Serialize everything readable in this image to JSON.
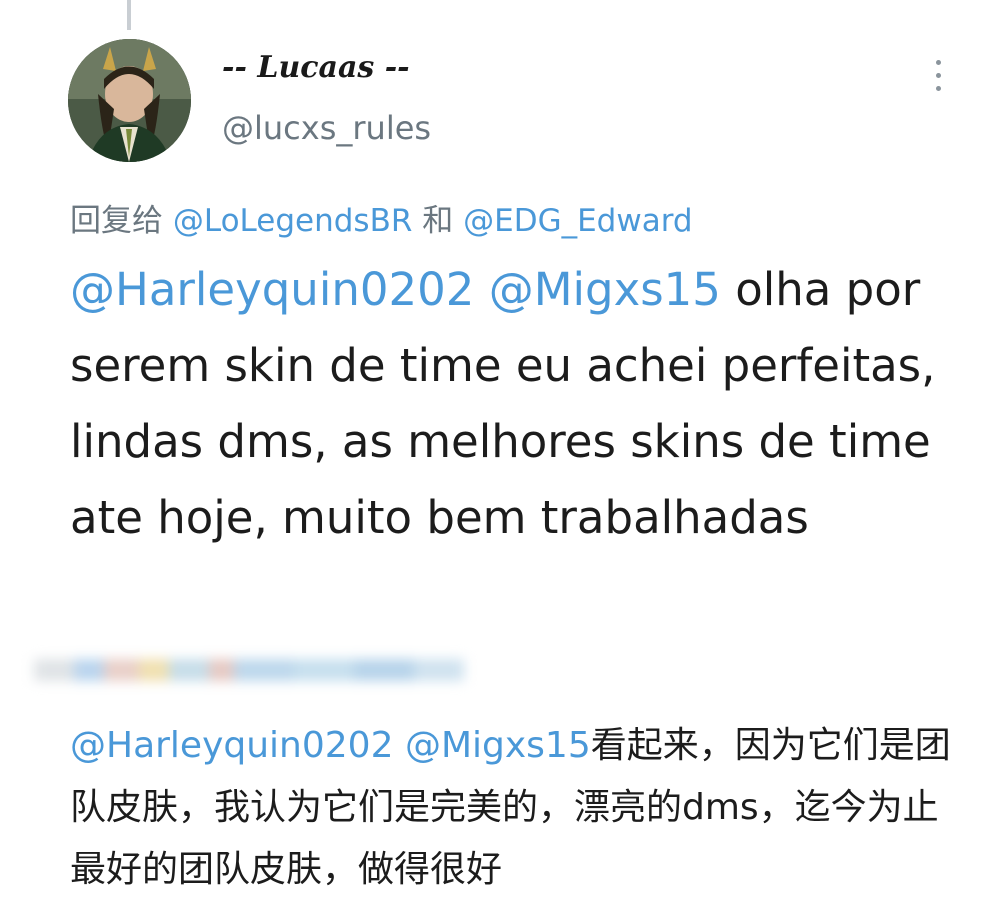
{
  "author": {
    "display_name": "-- Lucaas --",
    "handle": "@lucxs_rules"
  },
  "menu": {
    "icon": "more-vertical-icon"
  },
  "reply_context": {
    "prefix": "回复给 ",
    "mention_1": "@LoLegendsBR",
    "conjunction": " 和 ",
    "mention_2": "@EDG_Edward"
  },
  "tweet": {
    "mention_1": "@Harleyquin0202",
    "mention_2": "@Migxs15",
    "body": " olha por serem skin de time eu achei perfeitas, lindas dms, as melhores skins de time ate hoje, muito bem trabalhadas"
  },
  "translation": {
    "mention_1": "@Harleyquin0202",
    "mention_2": "@Migxs15",
    "body": "看起来，因为它们是团队皮肤，我认为它们是完美的，漂亮的dms，迄今为止最好的团队皮肤，做得很好"
  },
  "colors": {
    "mention": "#4a98d8",
    "secondary_text": "#6b7780",
    "primary_text": "#1c1c1c"
  }
}
